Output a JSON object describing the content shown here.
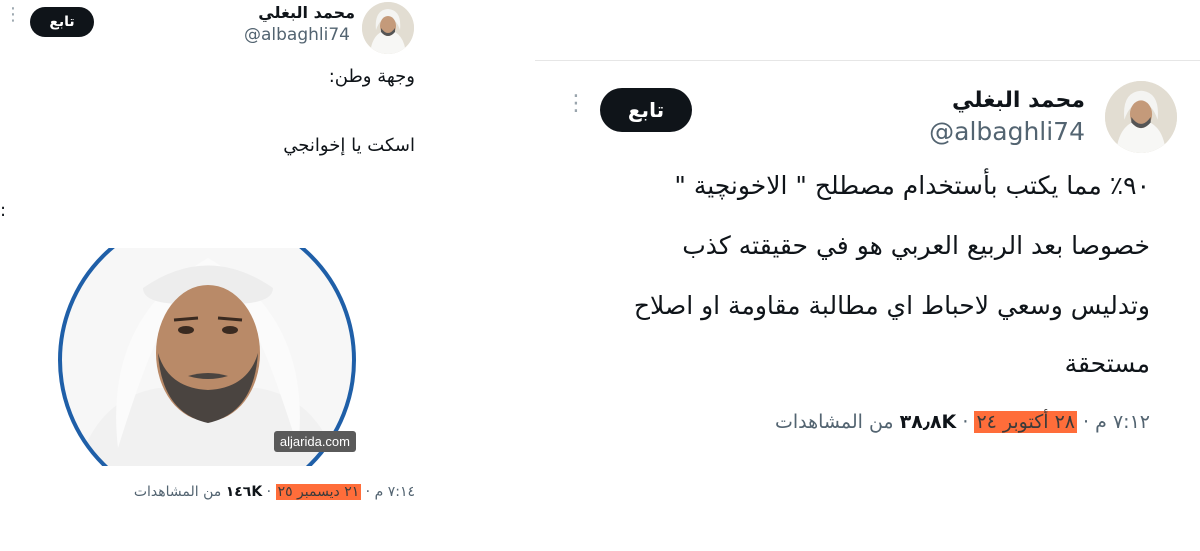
{
  "left_tweet": {
    "display_name": "محمد البغلي",
    "handle": "@albaghli74",
    "follow_label": "تابع",
    "text_line1": "وجهة وطن:",
    "text_line2": "اسكت يا إخوانجي",
    "image_watermark": "aljarida.com",
    "meta": {
      "time": "٧:١٤ م",
      "date": "٢١ ديسمبر ٢٥",
      "views_count": "١٤٦K",
      "views_label": "من المشاهدات"
    }
  },
  "right_tweet": {
    "display_name": "محمد البغلي",
    "handle": "@albaghli74",
    "follow_label": "تابع",
    "lines": [
      "٩٠٪ مما يكتب بأستخدام مصطلح \" الاخونچية \"",
      "خصوصا بعد الربيع العربي هو في حقيقته كذب",
      "وتدليس وسعي لاحباط اي مطالبة مقاومة او اصلاح",
      "مستحقة"
    ],
    "meta": {
      "time": "٧:١٢ م",
      "date": "٢٨ أكتوبر ٢٤",
      "views_count": "٣٨٫٨K",
      "views_label": "من المشاهدات"
    }
  },
  "colors": {
    "highlight": "#ff6d3a",
    "button": "#0f1419",
    "secondary_text": "#536471",
    "photo_ring": "#1f5fa8"
  }
}
